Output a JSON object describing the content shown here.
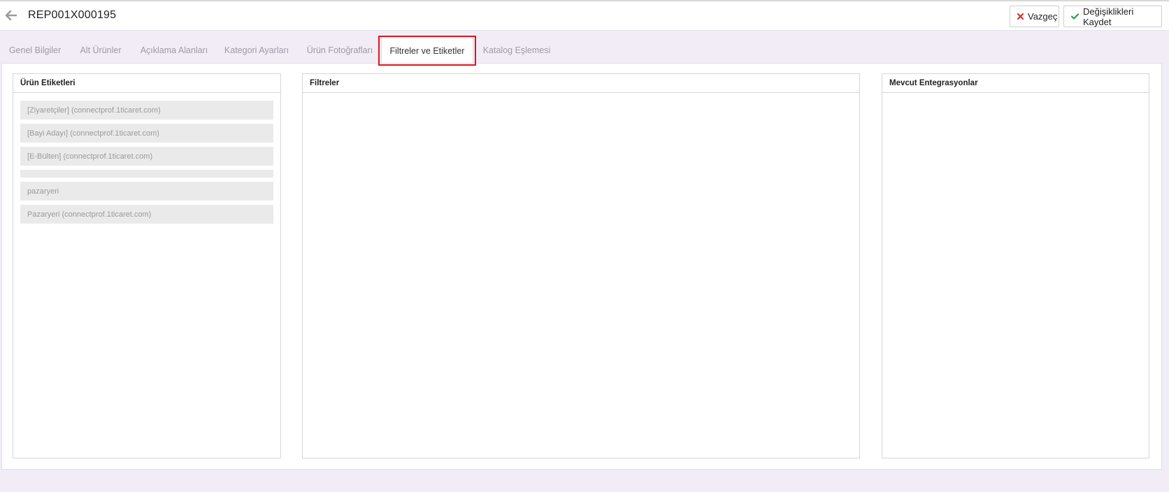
{
  "header": {
    "title": "REP001X000195",
    "cancel_label": "Vazgeç",
    "save_label": "Değişiklikleri Kaydet"
  },
  "tabs": [
    {
      "label": "Genel Bilgiler"
    },
    {
      "label": "Alt Ürünler"
    },
    {
      "label": "Açıklama Alanları"
    },
    {
      "label": "Kategori Ayarları"
    },
    {
      "label": "Ürün Fotoğrafları"
    },
    {
      "label": "Filtreler ve Etiketler",
      "active": true
    },
    {
      "label": "Katalog Eşlemesi"
    }
  ],
  "panels": {
    "tags": {
      "title": "Ürün Etiketleri",
      "items": [
        {
          "label": "[Ziyaretçiler] (connectprof.1ticaret.com)"
        },
        {
          "label": "[Bayi Adayı] (connectprof.1ticaret.com)"
        },
        {
          "label": "[E-Bülten] (connectprof.1ticaret.com)"
        },
        {
          "label": ""
        },
        {
          "label": "pazaryeri"
        },
        {
          "label": "Pazaryeri (connectprof.1ticaret.com)"
        }
      ]
    },
    "filters": {
      "title": "Filtreler"
    },
    "integrations": {
      "title": "Mevcut Entegrasyonlar"
    }
  },
  "colors": {
    "background": "#f1ecf6",
    "highlight": "#e0141b",
    "cancel_icon": "#d9302c",
    "save_icon": "#2a9d4a"
  },
  "icons": {
    "back": "arrow-left-icon",
    "cancel": "x-icon",
    "save": "check-icon"
  }
}
